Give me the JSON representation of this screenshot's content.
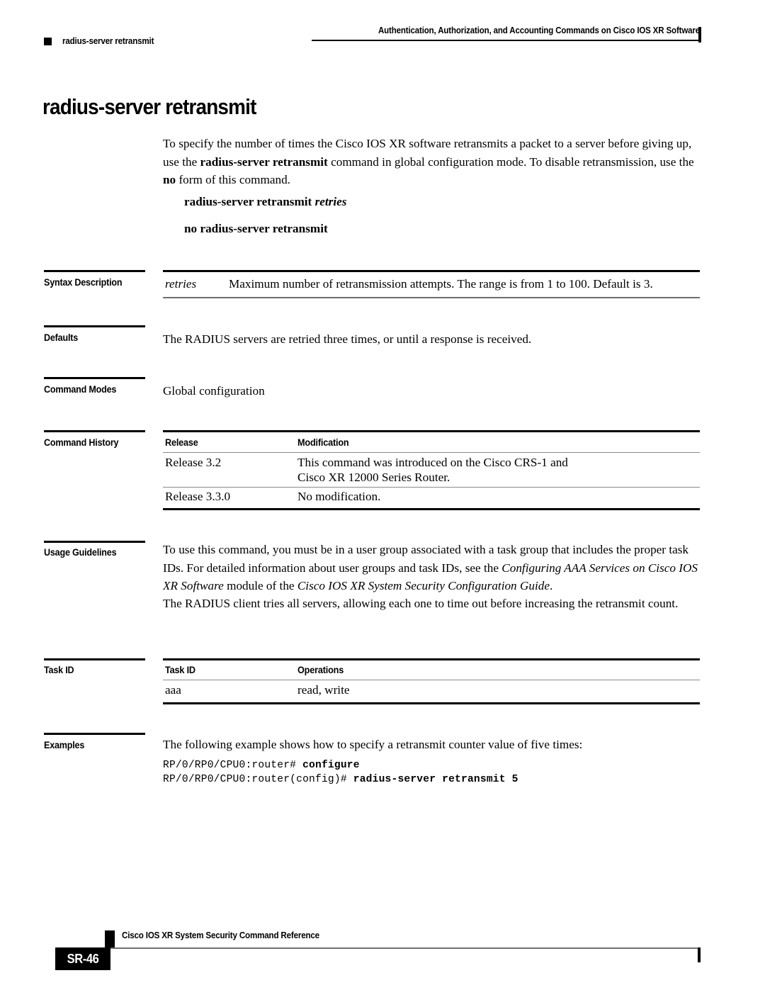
{
  "header": {
    "chapter_title": "Authentication, Authorization, and Accounting Commands on Cisco IOS XR Software",
    "running_head": "radius-server retransmit"
  },
  "page": {
    "command_title": "radius-server retransmit",
    "intro": {
      "part1": "To specify the number of times the Cisco IOS XR software retransmits a packet to a server before giving up, use the ",
      "bold1": "radius-server retransmit",
      "part2": " command in global configuration mode. To disable retransmission, use the ",
      "bold2": "no",
      "part3": " form of this command."
    },
    "syntax": {
      "command": "radius-server retransmit ",
      "argument": "retries",
      "no_form": "no radius-server retransmit"
    }
  },
  "sections": {
    "syntax_description": {
      "label": "Syntax Description",
      "rows": [
        {
          "term": "retries",
          "description": "Maximum number of retransmission attempts. The range is from 1 to 100. Default is 3."
        }
      ]
    },
    "defaults": {
      "label": "Defaults",
      "text": "The RADIUS servers are retried three times, or until a response is received."
    },
    "command_modes": {
      "label": "Command Modes",
      "text": "Global configuration"
    },
    "command_history": {
      "label": "Command History",
      "headers": {
        "release": "Release",
        "modification": "Modification"
      },
      "rows": [
        {
          "release": "Release 3.2",
          "modification_line1": "This command was introduced on the Cisco CRS-1 and",
          "modification_line2": "Cisco XR 12000 Series Router."
        },
        {
          "release": "Release 3.3.0",
          "modification_line1": "No modification.",
          "modification_line2": ""
        }
      ]
    },
    "usage_guidelines": {
      "label": "Usage Guidelines",
      "para1": {
        "part1": "To use this command, you must be in a user group associated with a task group that includes the proper task IDs. For detailed information about user groups and task IDs, see the ",
        "italic1": "Configuring AAA Services on Cisco IOS XR Software",
        "part2": " module of the ",
        "italic2": "Cisco IOS XR System Security Configuration Guide",
        "part3": "."
      },
      "para2": "The RADIUS client tries all servers, allowing each one to time out before increasing the retransmit count."
    },
    "task_id": {
      "label": "Task ID",
      "headers": {
        "task_id": "Task ID",
        "operations": "Operations"
      },
      "rows": [
        {
          "task_id": "aaa",
          "operations": "read, write"
        }
      ]
    },
    "examples": {
      "label": "Examples",
      "intro": "The following example shows how to specify a retransmit counter value of five times:",
      "cli": [
        {
          "prompt": "RP/0/RP0/CPU0:router# ",
          "command": "configure"
        },
        {
          "prompt": "RP/0/RP0/CPU0:router(config)# ",
          "command": "radius-server retransmit 5"
        }
      ]
    }
  },
  "footer": {
    "doc_title": "Cisco IOS XR System Security Command Reference",
    "page_number": "SR-46"
  }
}
